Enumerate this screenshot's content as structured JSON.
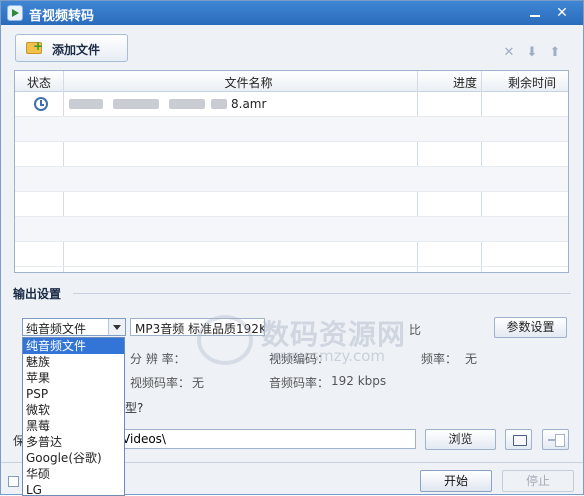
{
  "window": {
    "title": "音视频转码",
    "close_glyph": "✕"
  },
  "toolbar": {
    "add_file_label": "添加文件",
    "delete_glyph": "✕",
    "down_glyph": "⬇",
    "up_glyph": "⬆"
  },
  "table": {
    "columns": [
      "状态",
      "文件名称",
      "进度",
      "剩余时间"
    ],
    "rows": [
      {
        "status": "waiting",
        "filename_visible_suffix": "8.amr",
        "progress": "",
        "remaining": ""
      }
    ]
  },
  "output": {
    "section_title": "输出设置",
    "format_selected": "纯音频文件",
    "format_options": [
      "纯音频文件",
      "魅族",
      "苹果",
      "PSP",
      "微软",
      "黑莓",
      "多普达",
      "Google(谷歌)",
      "华硕",
      "LG"
    ],
    "preset_value": "MP3音频 标准品质192K",
    "param_button": "参数设置",
    "resolution_label": "分 辨 率：",
    "video_encoding_label": "视频编码：",
    "video_encoding_value": "无",
    "video_bitrate_label": "视频码率：",
    "video_bitrate_value": "无",
    "audio_bitrate_label": "音频码率：",
    "audio_bitrate_value": "192 kbps",
    "partial_question": "型?",
    "partial_right": "比",
    "partial_audio": "频率："
  },
  "save": {
    "label": "保",
    "path": "\\Videos\\",
    "browse_button": "浏览"
  },
  "actions": {
    "start_button": "开始",
    "stop_button": "停止"
  },
  "watermark": {
    "text": "数码资源网",
    "url": "www.smzy.com"
  }
}
